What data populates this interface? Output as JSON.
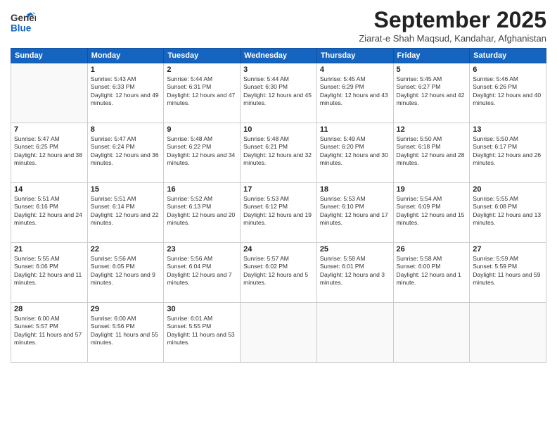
{
  "header": {
    "logo_general": "General",
    "logo_blue": "Blue",
    "month_title": "September 2025",
    "subtitle": "Ziarat-e Shah Maqsud, Kandahar, Afghanistan"
  },
  "weekdays": [
    "Sunday",
    "Monday",
    "Tuesday",
    "Wednesday",
    "Thursday",
    "Friday",
    "Saturday"
  ],
  "weeks": [
    [
      {
        "day": "",
        "sunrise": "",
        "sunset": "",
        "daylight": ""
      },
      {
        "day": "1",
        "sunrise": "Sunrise: 5:43 AM",
        "sunset": "Sunset: 6:33 PM",
        "daylight": "Daylight: 12 hours and 49 minutes."
      },
      {
        "day": "2",
        "sunrise": "Sunrise: 5:44 AM",
        "sunset": "Sunset: 6:31 PM",
        "daylight": "Daylight: 12 hours and 47 minutes."
      },
      {
        "day": "3",
        "sunrise": "Sunrise: 5:44 AM",
        "sunset": "Sunset: 6:30 PM",
        "daylight": "Daylight: 12 hours and 45 minutes."
      },
      {
        "day": "4",
        "sunrise": "Sunrise: 5:45 AM",
        "sunset": "Sunset: 6:29 PM",
        "daylight": "Daylight: 12 hours and 43 minutes."
      },
      {
        "day": "5",
        "sunrise": "Sunrise: 5:45 AM",
        "sunset": "Sunset: 6:27 PM",
        "daylight": "Daylight: 12 hours and 42 minutes."
      },
      {
        "day": "6",
        "sunrise": "Sunrise: 5:46 AM",
        "sunset": "Sunset: 6:26 PM",
        "daylight": "Daylight: 12 hours and 40 minutes."
      }
    ],
    [
      {
        "day": "7",
        "sunrise": "Sunrise: 5:47 AM",
        "sunset": "Sunset: 6:25 PM",
        "daylight": "Daylight: 12 hours and 38 minutes."
      },
      {
        "day": "8",
        "sunrise": "Sunrise: 5:47 AM",
        "sunset": "Sunset: 6:24 PM",
        "daylight": "Daylight: 12 hours and 36 minutes."
      },
      {
        "day": "9",
        "sunrise": "Sunrise: 5:48 AM",
        "sunset": "Sunset: 6:22 PM",
        "daylight": "Daylight: 12 hours and 34 minutes."
      },
      {
        "day": "10",
        "sunrise": "Sunrise: 5:48 AM",
        "sunset": "Sunset: 6:21 PM",
        "daylight": "Daylight: 12 hours and 32 minutes."
      },
      {
        "day": "11",
        "sunrise": "Sunrise: 5:49 AM",
        "sunset": "Sunset: 6:20 PM",
        "daylight": "Daylight: 12 hours and 30 minutes."
      },
      {
        "day": "12",
        "sunrise": "Sunrise: 5:50 AM",
        "sunset": "Sunset: 6:18 PM",
        "daylight": "Daylight: 12 hours and 28 minutes."
      },
      {
        "day": "13",
        "sunrise": "Sunrise: 5:50 AM",
        "sunset": "Sunset: 6:17 PM",
        "daylight": "Daylight: 12 hours and 26 minutes."
      }
    ],
    [
      {
        "day": "14",
        "sunrise": "Sunrise: 5:51 AM",
        "sunset": "Sunset: 6:16 PM",
        "daylight": "Daylight: 12 hours and 24 minutes."
      },
      {
        "day": "15",
        "sunrise": "Sunrise: 5:51 AM",
        "sunset": "Sunset: 6:14 PM",
        "daylight": "Daylight: 12 hours and 22 minutes."
      },
      {
        "day": "16",
        "sunrise": "Sunrise: 5:52 AM",
        "sunset": "Sunset: 6:13 PM",
        "daylight": "Daylight: 12 hours and 20 minutes."
      },
      {
        "day": "17",
        "sunrise": "Sunrise: 5:53 AM",
        "sunset": "Sunset: 6:12 PM",
        "daylight": "Daylight: 12 hours and 19 minutes."
      },
      {
        "day": "18",
        "sunrise": "Sunrise: 5:53 AM",
        "sunset": "Sunset: 6:10 PM",
        "daylight": "Daylight: 12 hours and 17 minutes."
      },
      {
        "day": "19",
        "sunrise": "Sunrise: 5:54 AM",
        "sunset": "Sunset: 6:09 PM",
        "daylight": "Daylight: 12 hours and 15 minutes."
      },
      {
        "day": "20",
        "sunrise": "Sunrise: 5:55 AM",
        "sunset": "Sunset: 6:08 PM",
        "daylight": "Daylight: 12 hours and 13 minutes."
      }
    ],
    [
      {
        "day": "21",
        "sunrise": "Sunrise: 5:55 AM",
        "sunset": "Sunset: 6:06 PM",
        "daylight": "Daylight: 12 hours and 11 minutes."
      },
      {
        "day": "22",
        "sunrise": "Sunrise: 5:56 AM",
        "sunset": "Sunset: 6:05 PM",
        "daylight": "Daylight: 12 hours and 9 minutes."
      },
      {
        "day": "23",
        "sunrise": "Sunrise: 5:56 AM",
        "sunset": "Sunset: 6:04 PM",
        "daylight": "Daylight: 12 hours and 7 minutes."
      },
      {
        "day": "24",
        "sunrise": "Sunrise: 5:57 AM",
        "sunset": "Sunset: 6:02 PM",
        "daylight": "Daylight: 12 hours and 5 minutes."
      },
      {
        "day": "25",
        "sunrise": "Sunrise: 5:58 AM",
        "sunset": "Sunset: 6:01 PM",
        "daylight": "Daylight: 12 hours and 3 minutes."
      },
      {
        "day": "26",
        "sunrise": "Sunrise: 5:58 AM",
        "sunset": "Sunset: 6:00 PM",
        "daylight": "Daylight: 12 hours and 1 minute."
      },
      {
        "day": "27",
        "sunrise": "Sunrise: 5:59 AM",
        "sunset": "Sunset: 5:59 PM",
        "daylight": "Daylight: 11 hours and 59 minutes."
      }
    ],
    [
      {
        "day": "28",
        "sunrise": "Sunrise: 6:00 AM",
        "sunset": "Sunset: 5:57 PM",
        "daylight": "Daylight: 11 hours and 57 minutes."
      },
      {
        "day": "29",
        "sunrise": "Sunrise: 6:00 AM",
        "sunset": "Sunset: 5:56 PM",
        "daylight": "Daylight: 11 hours and 55 minutes."
      },
      {
        "day": "30",
        "sunrise": "Sunrise: 6:01 AM",
        "sunset": "Sunset: 5:55 PM",
        "daylight": "Daylight: 11 hours and 53 minutes."
      },
      {
        "day": "",
        "sunrise": "",
        "sunset": "",
        "daylight": ""
      },
      {
        "day": "",
        "sunrise": "",
        "sunset": "",
        "daylight": ""
      },
      {
        "day": "",
        "sunrise": "",
        "sunset": "",
        "daylight": ""
      },
      {
        "day": "",
        "sunrise": "",
        "sunset": "",
        "daylight": ""
      }
    ]
  ]
}
